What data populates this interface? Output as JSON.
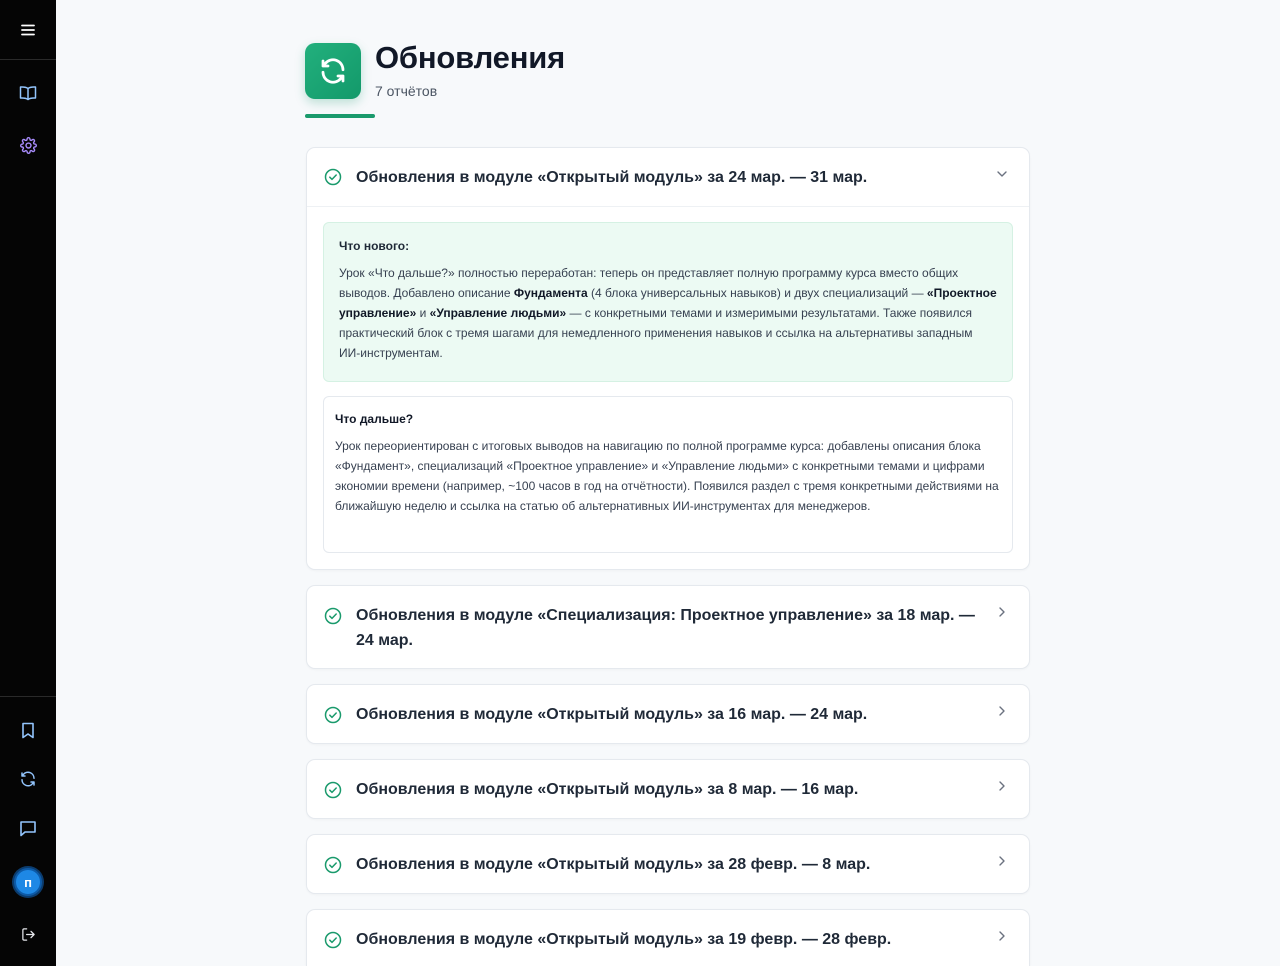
{
  "sidebar": {
    "icons": [
      "menu-icon",
      "book-icon",
      "gear-icon",
      "bookmark-icon",
      "refresh-icon",
      "chat-icon",
      "logout-icon"
    ],
    "avatar_letter": "п",
    "colors": {
      "background": "#050505",
      "settings_accent": "#a78bfa",
      "icon": "#93c5fd",
      "avatar": "#1e88e5"
    }
  },
  "header": {
    "title": "Обновления",
    "subtitle": "7 отчётов",
    "icon": "refresh-icon",
    "accent": "#1a9a6c"
  },
  "reports": [
    {
      "title": "Обновления в модуле «Открытый модуль» за 24 мар. — 31 мар.",
      "expanded": true,
      "whats_new": {
        "heading": "Что нового:",
        "p1": "Урок «Что дальше?» полностью переработан: теперь он представляет полную программу курса вместо общих выводов. Добавлено описание ",
        "b1": "Фундамента",
        "p2": " (4 блока универсальных навыков) и двух специализаций — ",
        "b2": "«Проектное управление»",
        "p3": " и ",
        "b3": "«Управление людьми»",
        "p4": " — с конкретными темами и измеримыми результатами. Также появился практический блок с тремя шагами для немедленного применения навыков и ссылка на альтернативы западным ИИ-инструментам."
      },
      "lesson": {
        "heading": "Что дальше?",
        "body": "Урок переориентирован с итоговых выводов на навигацию по полной программе курса: добавлены описания блока «Фундамент», специализаций «Проектное управление» и «Управление людьми» с конкретными темами и цифрами экономии времени (например, ~100 часов в год на отчётности). Появился раздел с тремя конкретными действиями на ближайшую неделю и ссылка на статью об альтернативных ИИ-инструментах для менеджеров."
      }
    },
    {
      "title": "Обновления в модуле «Специализация: Проектное управление» за 18 мар. — 24 мар.",
      "expanded": false
    },
    {
      "title": "Обновления в модуле «Открытый модуль» за 16 мар. — 24 мар.",
      "expanded": false
    },
    {
      "title": "Обновления в модуле «Открытый модуль» за 8 мар. — 16 мар.",
      "expanded": false
    },
    {
      "title": "Обновления в модуле «Открытый модуль» за 28 февр. — 8 мар.",
      "expanded": false
    },
    {
      "title": "Обновления в модуле «Открытый модуль» за 19 февр. — 28 февр.",
      "expanded": false
    }
  ],
  "colors": {
    "check": "#1a9a6c",
    "whats_new_bg": "#ecfaf3"
  }
}
